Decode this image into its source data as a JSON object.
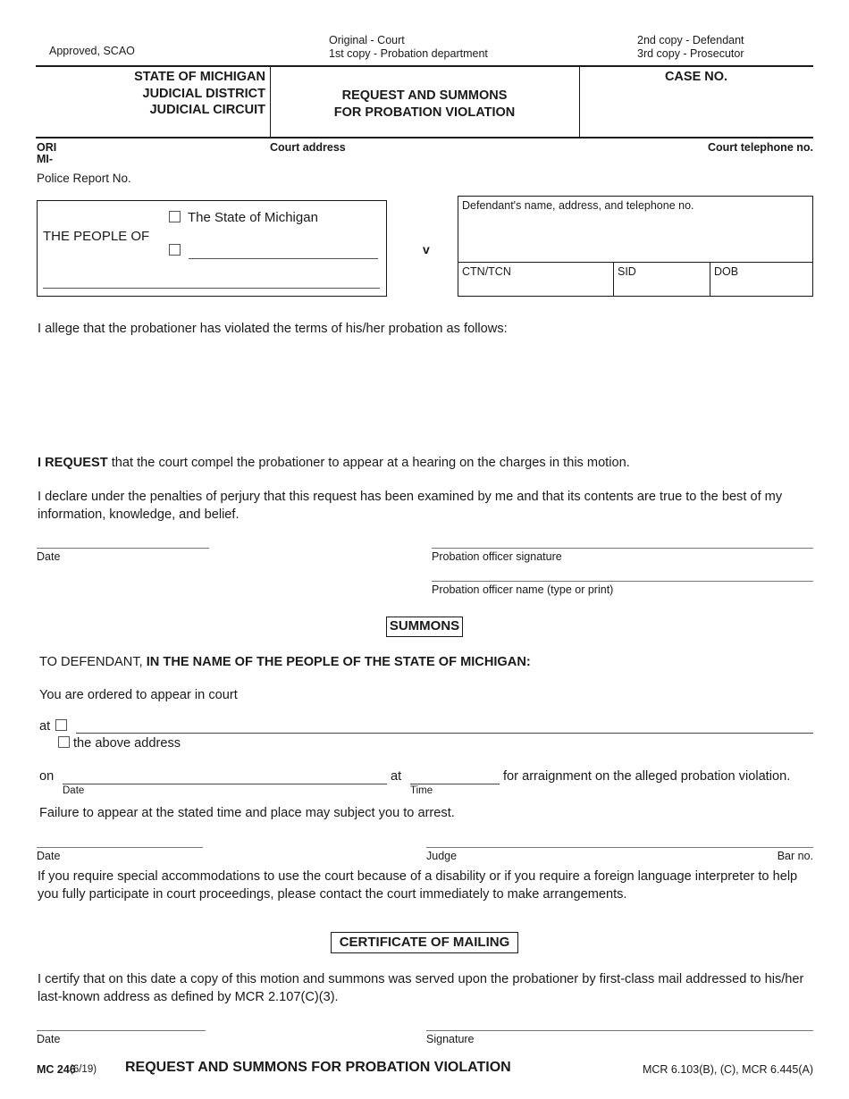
{
  "header": {
    "approved": "Approved, SCAO",
    "copies_center": [
      "Original - Court",
      "1st copy - Probation department"
    ],
    "copies_right": [
      "2nd copy - Defendant",
      "3rd copy - Prosecutor"
    ],
    "state_line1": "STATE OF MICHIGAN",
    "state_line2": "JUDICIAL DISTRICT",
    "state_line3": "JUDICIAL CIRCUIT",
    "form_title_line1": "REQUEST AND SUMMONS",
    "form_title_line2": "FOR PROBATION VIOLATION",
    "case_no_label": "CASE NO."
  },
  "ori_row": {
    "ori_label": "ORI",
    "ori_prefix": "MI-",
    "court_address_label": "Court address",
    "court_telephone_label": "Court telephone no.",
    "police_report_label": "Police Report No."
  },
  "parties": {
    "people_of_label": "THE PEOPLE OF",
    "checkbox_state_label": "The State of Michigan",
    "checkbox_other_label": "",
    "versus": "v",
    "defendant_box_label": "Defendant's name, address, and telephone no.",
    "ctn_tcn_label": "CTN/TCN",
    "sid_label": "SID",
    "dob_label": "DOB"
  },
  "allegation": {
    "text": "I allege that the probationer has violated the terms of his/her probation as follows:"
  },
  "request": {
    "bold_lead": "I REQUEST",
    "rest": " that the court compel the probationer to appear at a hearing on the charges in this motion.",
    "declaration": "I declare under the penalties of perjury that this request has been examined by me and that its contents are true to the best of my information, knowledge, and belief."
  },
  "request_signatures": {
    "date_label": "Date",
    "probation_officer_signature_label": "Probation officer signature",
    "probation_officer_name_label": "Probation officer name (type or print)"
  },
  "summons": {
    "section_title": "SUMMONS",
    "to_defendant_prefix": "TO DEFENDANT, ",
    "to_defendant_bold": "IN THE NAME OF THE PEOPLE OF THE STATE OF MICHIGAN:",
    "ordered_text": "You are ordered to appear in court",
    "at_label": "at",
    "above_address_label": "the above address",
    "on_label": "on",
    "on_date_label": "Date",
    "at2_label": "at",
    "time_label": "Time",
    "arraignment_text": "for arraignment on the alleged probation violation.",
    "failure_text": "Failure to appear at the stated time and place may subject you to arrest."
  },
  "judge_signatures": {
    "date_label": "Date",
    "judge_label": "Judge",
    "bar_no_label": "Bar no."
  },
  "accommodations": {
    "text": "If you require special accommodations to use the court because of a disability or if you require a foreign language interpreter to help you fully participate in court proceedings, please contact the court immediately to make arrangements."
  },
  "certificate": {
    "section_title": "CERTIFICATE OF MAILING",
    "text": "I certify that on this date a copy of this motion and summons was served upon the probationer by first-class mail addressed to his/her last-known address as defined by MCR 2.107(C)(3).",
    "date_label": "Date",
    "signature_label": "Signature"
  },
  "footer": {
    "form_code": "MC 246",
    "revision": "(6/19)",
    "title": "REQUEST AND SUMMONS FOR PROBATION VIOLATION",
    "mcr_reference": "MCR 6.103(B), (C), MCR 6.445(A)"
  }
}
